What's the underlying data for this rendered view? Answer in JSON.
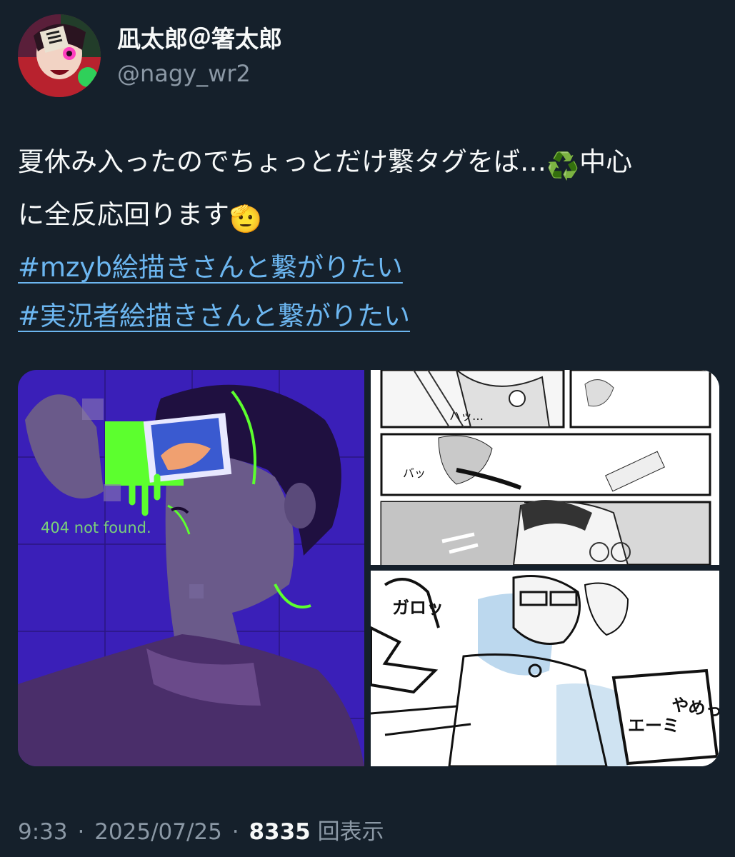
{
  "author": {
    "display_name": "凪太郎＠箸太郎",
    "handle": "@nagy_wr2"
  },
  "tweet": {
    "text_line1": "夏休み入ったのでちょっとだけ繋タグをば…",
    "emoji_recycle": "♻️",
    "text_line1_end": "中心",
    "text_line2": "に全反応回ります",
    "emoji_pointing": "🫡",
    "hashtags": [
      "#mzyb絵描きさんと繋がりたい",
      "#実況者絵描きさんと繋がりたい"
    ]
  },
  "media": {
    "illustration_caption": "404 not found.",
    "comic_sfx_1": "ハッ…",
    "comic_sfx_2": "バッ",
    "comic_sfx_3": "ガロッ",
    "comic_sfx_4": "やめっ",
    "comic_sfx_5": "エーミ"
  },
  "meta": {
    "time": "9:33",
    "separator": "·",
    "date": "2025/07/25",
    "views_count": "8335",
    "views_label": "回表示"
  },
  "colors": {
    "background": "#15202b",
    "text": "#f7f9f9",
    "secondary": "#8b98a5",
    "link": "#6cb6f0",
    "illustration_bg": "#3a1fb8",
    "neon_green": "#5cff2e"
  }
}
